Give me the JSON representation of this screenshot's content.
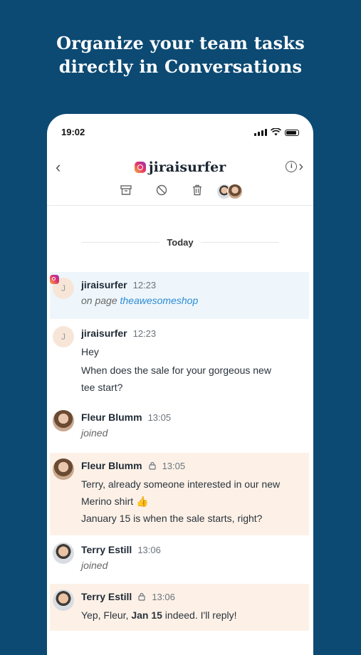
{
  "headline": {
    "line1": "Organize your team tasks",
    "line2": "directly in Conversations"
  },
  "status_bar": {
    "time": "19:02"
  },
  "header": {
    "title": "jiraisurfer",
    "info_glyph": "i"
  },
  "divider": {
    "label": "Today"
  },
  "messages": [
    {
      "name": "jiraisurfer",
      "time": "12:23",
      "avatar_letter": "J",
      "prefix": "on page ",
      "link": "theawesomeshop"
    },
    {
      "name": "jiraisurfer",
      "time": "12:23",
      "avatar_letter": "J",
      "lines": [
        "Hey",
        "When does the sale for your gorgeous new",
        "tee start?"
      ]
    },
    {
      "name": "Fleur Blumm",
      "time": "13:05",
      "system": "joined"
    },
    {
      "name": "Fleur Blumm",
      "time": "13:05",
      "lines": [
        "Terry, already someone interested in our new",
        "Merino shirt 👍",
        "January 15 is when the sale starts, right?"
      ]
    },
    {
      "name": "Terry Estill",
      "time": "13:06",
      "system": "joined"
    },
    {
      "name": "Terry Estill",
      "time": "13:06",
      "reply_pre": "Yep, Fleur, ",
      "reply_bold": "Jan 15",
      "reply_post": " indeed. I'll reply!"
    }
  ],
  "colors": {
    "background": "#0c4a73",
    "note_bg": "#fdf1e7",
    "external_bg": "#eef6fb",
    "link": "#2a8bd6"
  },
  "icons": [
    "back-chevron-icon",
    "instagram-icon",
    "info-icon",
    "archive-icon",
    "block-icon",
    "trash-icon",
    "lock-icon"
  ]
}
